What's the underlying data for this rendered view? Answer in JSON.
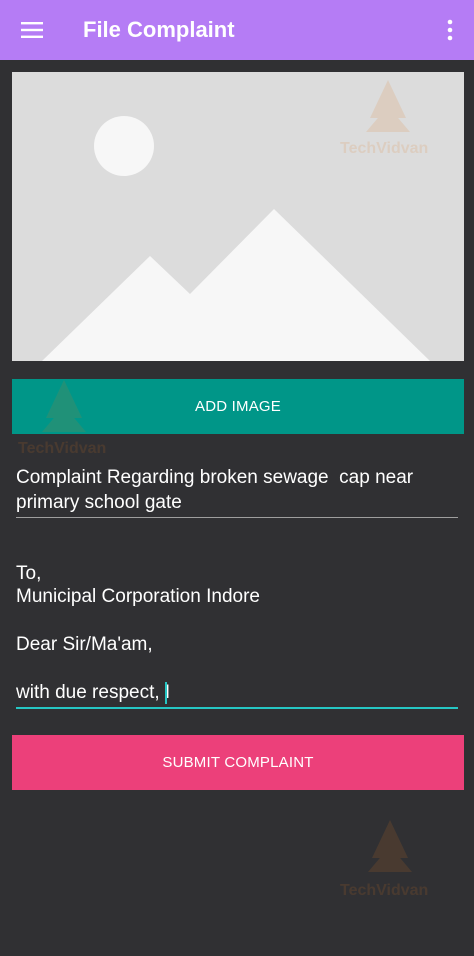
{
  "app_bar": {
    "title": "File Complaint",
    "menu_icon": "hamburger-menu-icon",
    "overflow_icon": "more-vert-icon",
    "color": "#b57cf5"
  },
  "image_placeholder": {
    "icon": "image-placeholder-icon"
  },
  "add_image_button": {
    "label": "ADD IMAGE",
    "color": "#009688"
  },
  "subject_field": {
    "value": "Complaint Regarding broken sewage  cap near primary school gate"
  },
  "body_field": {
    "lines": [
      "To,",
      "Municipal Corporation Indore",
      "",
      "Dear Sir/Ma'am,",
      "",
      "with due respect, I"
    ],
    "accent_color": "#26c6c4"
  },
  "submit_button": {
    "label": "SUBMIT COMPLAINT",
    "color": "#ec407a"
  },
  "watermark": {
    "brand": "TechVidvan",
    "brand_part_1": "Tech",
    "brand_part_2": "Vidvan"
  }
}
